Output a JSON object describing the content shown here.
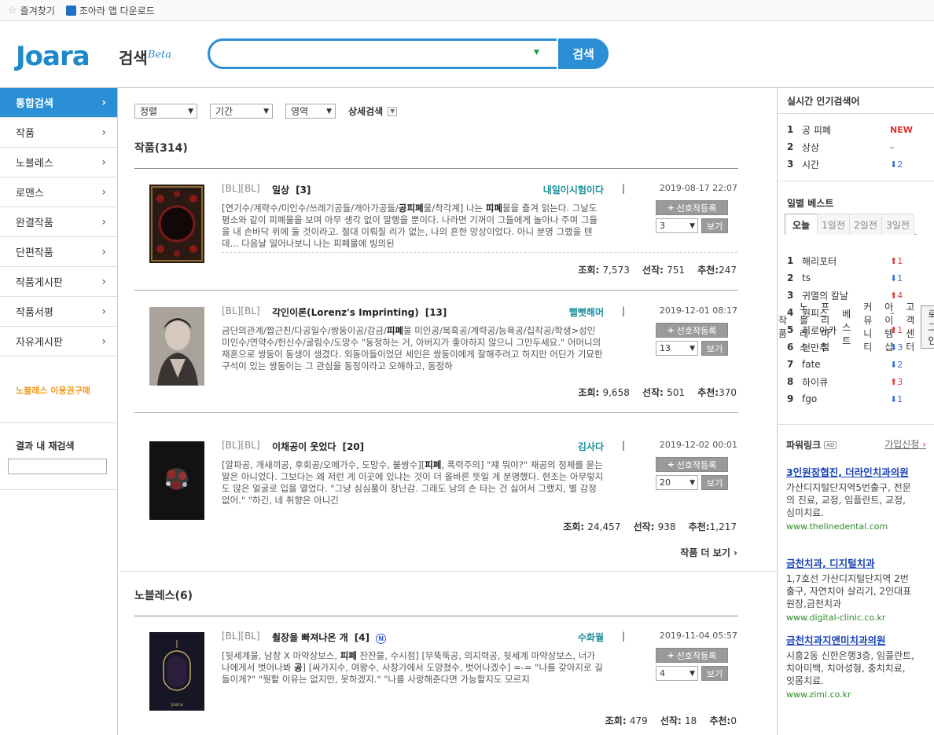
{
  "topbar": {
    "favorites": "즐겨찾기",
    "app_download": "조아라 앱 다운로드",
    "nav": [
      "작품",
      "노블레스",
      "프리미엄",
      "베스트",
      "커뮤니티",
      "아이템샵",
      "고객센터"
    ],
    "login": "로그인"
  },
  "header": {
    "logo": "Joara",
    "search_title": "검색",
    "beta": "Beta",
    "search_value": "",
    "search_button": "검색"
  },
  "sidebar": {
    "items": [
      "통합검색",
      "작품",
      "노블레스",
      "로맨스",
      "완결작품",
      "단편작품",
      "작품게시판",
      "작품서평",
      "자유게시판"
    ],
    "promo": "노블레스 이용권구매",
    "research_title": "결과 내 재검색"
  },
  "filters": {
    "sort": "정렬",
    "period": "기간",
    "area": "영역",
    "detail": "상세검색"
  },
  "works": {
    "title": "작품(314)",
    "more": "작품 더 보기",
    "items": [
      {
        "tags": "[BL][BL]",
        "title": "일상",
        "count": "[3]",
        "author": "내일이시험이다",
        "date": "2019-08-17 22:07",
        "desc_pre": "[연기수/계략수/미인수/쓰레기공들/개아가공들/",
        "desc_b1": "공피폐",
        "desc_mid": "물/착각계] 나는 ",
        "desc_b2": "피폐",
        "desc_post": "물을 즐겨 읽는다. 그날도 평소와 같이 피폐물을 보며 아무 생각 없이 말행을 뿐이다. 나라면 기꺼이 그들에게 놀아나 주며 그들을 내 손바닥 위에 둘 것이라고. 절대 이뤄질 리가 없는, 나의 흔한 망상이었다. 아니 분명 그랬을 텐데... 다음날 일어나보니 나는 피폐물에 빙의된",
        "fav": "선호작등록",
        "vol": "3",
        "view": "보기",
        "views_label": "조회:",
        "views": "7,573",
        "favs_label": "선작:",
        "favs": "751",
        "recs_label": "추천:",
        "recs": "247"
      },
      {
        "tags": "[BL][BL]",
        "title": "각인이론(Lorenz's Imprinting)",
        "count": "[13]",
        "author": "뻘뻣해머",
        "date": "2019-12-01 08:17",
        "desc_pre": "금단의관계/짭근친/다공일수/쌍둥이공/감금/",
        "desc_b1": "피폐",
        "desc_mid": "물 미인공/복흑공/계략공/능욕공/집착공/학생>성인 미인수/연약수/헌신수/굴림수/도망수 ",
        "desc_b2": "",
        "desc_post": "\"동정하는 거, 아버지가 좋아하지 않으니 그만두세요.\" 어머니의 재혼으로 쌍둥이 동생이 생겼다. 외동아들이었던 세인은 쌍둥이에게 잘해주려고 하지만 어딘가 기묘한 구석이 있는 쌍둥이는 그 관심을 동정이라고 오해하고, 동정하",
        "fav": "선호작등록",
        "vol": "13",
        "view": "보기",
        "views_label": "조회:",
        "views": "9,658",
        "favs_label": "선작:",
        "favs": "501",
        "recs_label": "추천:",
        "recs": "370"
      },
      {
        "tags": "[BL][BL]",
        "title": "이채공이 웃었다",
        "count": "[20]",
        "author": "김사다",
        "date": "2019-12-02 00:01",
        "desc_pre": "[알파공, 개새끼공, 후회공/오메가수, 도망수, 불쌍수][",
        "desc_b1": "피폐",
        "desc_mid": ", 폭력주의] \"쟤 뭐야?\" 채공의 정체를 묻는 말은 아니었다. 그보다는 왜 저런 게 이곳에 있냐는 것이 더 올바른 뜻일 게 분명했다. 현조는 아무렇지도 않은 얼굴로 입을 열었다. \"그냥 심심풀이 장난감. 그래도 남의 손 타는 건 싫어서 그랬지, 별 감정 없어.\" \"하긴, 네 취향은 아니긴",
        "desc_b2": "",
        "desc_post": "",
        "fav": "선호작등록",
        "vol": "20",
        "view": "보기",
        "views_label": "조회:",
        "views": "24,457",
        "favs_label": "선작:",
        "favs": "938",
        "recs_label": "추천:",
        "recs": "1,217"
      }
    ]
  },
  "noblesse": {
    "title": "노블레스(6)",
    "items": [
      {
        "tags": "[BL][BL]",
        "title": "쵤장을 빠져나온 개",
        "count": "[4]",
        "badge": "N",
        "author": "수화월",
        "date": "2019-11-04 05:57",
        "desc_pre": "[뒷세계물, 남창 X 마약상보스, ",
        "desc_b1": "피폐",
        "desc_mid": " 잔잔물, 수시점] [무뚝뚝공, 의지력공, 뒷세계 마약상보스, 너가 나에게서 벗어나봐 ",
        "desc_b2": "공",
        "desc_post": "] [싸가지수, 여왕수, 사창가에서 도망쳤수, 벗어나겠수] =-= \"나를 갖아지로 길들이게?\" \"뭣할 이유는 없지만, 못하겠지.\" \"나를 사랑해준다면 가능할지도 모르지",
        "fav": "선호작등록",
        "vol": "4",
        "view": "보기",
        "views_label": "조회:",
        "views": "479",
        "favs_label": "선작:",
        "favs": "18",
        "recs_label": "추천:",
        "recs": "0"
      }
    ]
  },
  "realtime": {
    "title": "실시간 인기검색어",
    "items": [
      {
        "n": "1",
        "word": "공 피폐",
        "change": "NEW"
      },
      {
        "n": "2",
        "word": "상상",
        "change": "–"
      },
      {
        "n": "3",
        "word": "시간",
        "change": "2"
      }
    ]
  },
  "daily": {
    "title": "일별 베스트",
    "tabs": [
      "오늘",
      "1일전",
      "2일전",
      "3일전"
    ],
    "items": [
      {
        "n": "1",
        "word": "해리포터",
        "change": "1"
      },
      {
        "n": "2",
        "word": "ts",
        "change": "1"
      },
      {
        "n": "3",
        "word": "귀멸의 칼날",
        "change": "4"
      },
      {
        "n": "4",
        "word": "원피스",
        "change": "–"
      },
      {
        "n": "5",
        "word": "히로아카",
        "change": "1"
      },
      {
        "n": "6",
        "word": "던만추",
        "change": "3"
      },
      {
        "n": "7",
        "word": "fate",
        "change": "2"
      },
      {
        "n": "8",
        "word": "하이큐",
        "change": "3"
      },
      {
        "n": "9",
        "word": "fgo",
        "change": "1"
      }
    ]
  },
  "powerlink": {
    "title": "파워링크",
    "ad": "AD",
    "join": "가입신청",
    "items": [
      {
        "head": "3인원장협진, 더라인치과의원",
        "body": "가산디지털단지역5번출구, 전문의 진료, 교정, 임플란트, 교정, 심미치료.",
        "url": "www.thelinedental.com"
      },
      {
        "head": "금천치과, 디지털치과",
        "body": "1,7호선 가산디지털단지역 2번출구, 자연치아 살리기, 2인대표원장,금천치과",
        "url": "www.digital-clinic.co.kr"
      },
      {
        "head": "금천치과지앤미치과의원",
        "body": "시흥2동 신한은행3층, 임플란트, 치아미백, 치아성형, 충치치료, 잇몸치료.",
        "url": "www.zimi.co.kr"
      }
    ]
  },
  "colors": {
    "accent": "#2b8fd6",
    "author": "#1a8f9c",
    "promo": "#f39a1e",
    "ad_link": "#1a44b8",
    "ad_url": "#2d8a2d"
  }
}
